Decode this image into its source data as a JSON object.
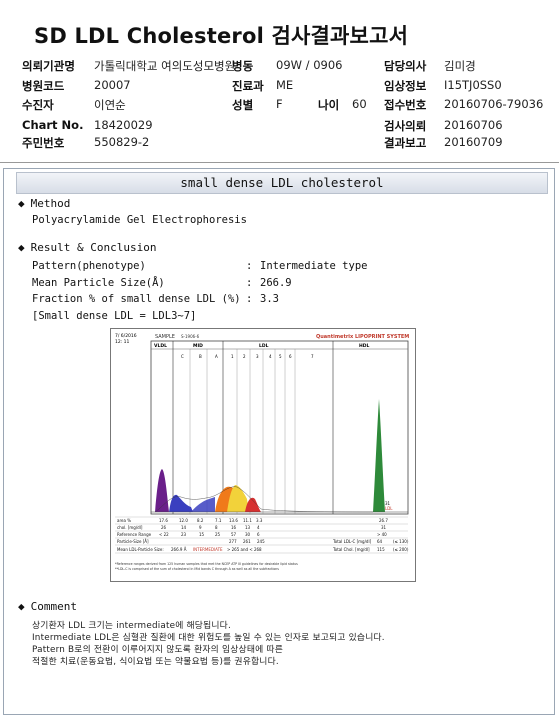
{
  "title": "SD LDL Cholesterol 검사결과보고서",
  "header": {
    "hospital_label": "의뢰기관명",
    "hospital_value": "가톨릭대학교 여의도성모병원",
    "ward_label": "병동",
    "ward_value": "09W / 0906",
    "doctor_label": "담당의사",
    "doctor_value": "김미경",
    "hospital_code_label": "병원코드",
    "hospital_code_value": "20007",
    "dept_label": "진료과",
    "dept_value": "ME",
    "clinical_label": "임상정보",
    "clinical_value": "I15TJ0SS0",
    "patient_label": "수진자",
    "patient_value": "이연순",
    "sex_label": "성별",
    "sex_value": "F",
    "age_label": "나이",
    "age_value": "60",
    "receipt_label": "접수번호",
    "receipt_value": "20160706-79036",
    "chart_label": "Chart No.",
    "chart_value": "18420029",
    "request_label": "검사의뢰",
    "request_value": "20160706",
    "ssn_label": "주민번호",
    "ssn_value": "550829-2",
    "result_label": "결과보고",
    "result_value": "20160709"
  },
  "banner": "small dense LDL cholesterol",
  "method": {
    "heading": "Method",
    "text": "Polyacrylamide Gel Electrophoresis"
  },
  "result": {
    "heading": "Result & Conclusion",
    "rows": [
      {
        "label": "Pattern(phenotype)",
        "sep": ":",
        "value": "Intermediate type"
      },
      {
        "label": "Mean Particle Size(Å)",
        "sep": ":",
        "value": "266.9"
      },
      {
        "label": "Fraction % of small dense LDL (%)",
        "sep": ":",
        "value": "3.3"
      }
    ],
    "note": "[Small dense LDL = LDL3~7]"
  },
  "chart_data": {
    "type": "area",
    "brand": "Quantimetrix LIPOPRINT SYSTEM",
    "sample_label": "SAMPLE",
    "sample_id": "S-1906-6",
    "date": "7/ 6/2016",
    "time": "12: 11",
    "band_labels": [
      "VLDL",
      "MID",
      "C",
      "B",
      "A",
      "1",
      "2",
      "3",
      "4",
      "5",
      "6",
      "7",
      "LDL",
      "HDL"
    ],
    "area_label": "area %",
    "area_values": [
      "17.6",
      "12.0",
      "8.2",
      "7.1",
      "13.6",
      "11.1",
      "3.3",
      "26.7"
    ],
    "chol_label": "chol. [mg/dl]",
    "chol_values": [
      "26",
      "14",
      "9",
      "8",
      "16",
      "13",
      "4",
      "31"
    ],
    "ref_label": "Reference Range",
    "ref_values": [
      "< 22",
      "23",
      "15",
      "25",
      "57",
      "30",
      "6",
      "> 40"
    ],
    "particle_label": "Particle-Size [Å]",
    "particle_values": [
      "277",
      "261",
      "245"
    ],
    "total_ldl_label": "Total LDL-C [mg/dl]",
    "total_ldl_value": "64",
    "total_ldl_ref": "(≤ 130)",
    "total_chol_label": "Total Chol. [mg/dl]",
    "total_chol_value": "115",
    "total_chol_ref": "(≤ 200)",
    "mean_label": "Mean LDL-Particle Size:",
    "mean_value": "266.9 Å",
    "mean_type": "INTERMEDIATE",
    "mean_range": "> 265 and < 268",
    "hdl_value_label": "31",
    "hdl_cat_label": "LDL",
    "footnote1": "*Reference ranges derived from 125 human samples that met the NCEP ATP III guidelines for desirable lipid status",
    "footnote2": "**LDL-C is comprised of the sum of cholesterol in Mid bands C through A as well as all the subfractions",
    "colors": {
      "vldl": "#6a1f8a",
      "mid": "#3a3fbf",
      "ldl_orange": "#f07a1a",
      "ldl_yellow": "#f2d23a",
      "ldl_red": "#d73030",
      "hdl": "#2e8a3a"
    }
  },
  "comment": {
    "heading": "Comment",
    "lines": [
      "상기환자 LDL 크기는 intermediate에 해당됩니다.",
      "Intermediate LDL은 심혈관 질환에 대한 위험도를 높일 수 있는 인자로 보고되고 있습니다.",
      "Pattern B로의 전환이 이루어지지 않도록 환자의 임상상태에 따른",
      "적절한 치료(운동요법, 식이요법 또는 약물요법 등)를 권유합니다."
    ]
  }
}
